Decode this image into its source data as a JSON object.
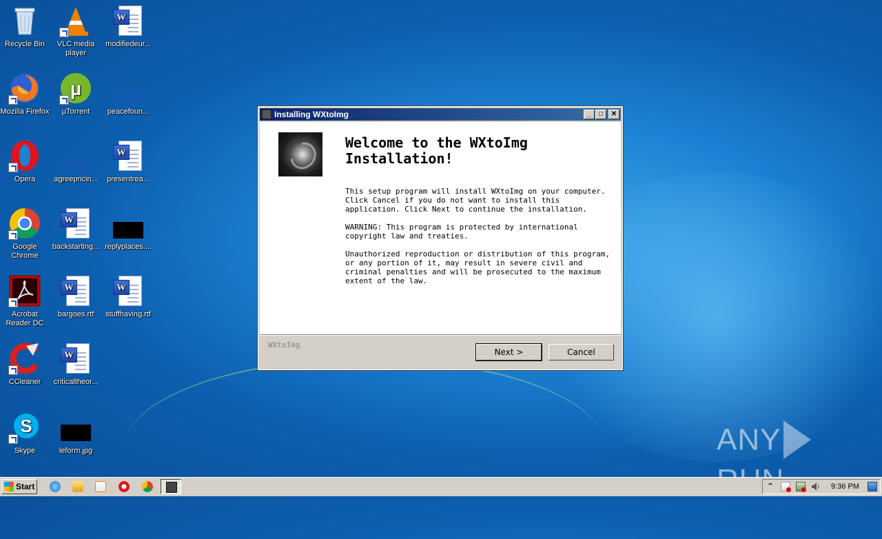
{
  "desktop": {
    "icons": [
      {
        "label": "Recycle Bin",
        "icon": "recycle-bin-icon"
      },
      {
        "label": "VLC media player",
        "icon": "vlc-icon"
      },
      {
        "label": "modifiedeur...",
        "icon": "word-document-icon"
      },
      {
        "label": "Mozilla Firefox",
        "icon": "firefox-icon"
      },
      {
        "label": "µTorrent",
        "icon": "utorrent-icon"
      },
      {
        "label": "peacefoun...",
        "icon": "file-icon"
      },
      {
        "label": "Opera",
        "icon": "opera-icon"
      },
      {
        "label": "agreepricin...",
        "icon": "file-icon"
      },
      {
        "label": "presentrea...",
        "icon": "word-document-icon"
      },
      {
        "label": "Google Chrome",
        "icon": "chrome-icon"
      },
      {
        "label": "backstarting...",
        "icon": "word-document-icon"
      },
      {
        "label": "replyplaces....",
        "icon": "black-thumbnail-icon"
      },
      {
        "label": "Acrobat Reader DC",
        "icon": "acrobat-icon"
      },
      {
        "label": "bargoes.rtf",
        "icon": "word-document-icon"
      },
      {
        "label": "stuffhaving.rtf",
        "icon": "word-document-icon"
      },
      {
        "label": "CCleaner",
        "icon": "ccleaner-icon"
      },
      {
        "label": "criticaltheor...",
        "icon": "word-document-icon"
      },
      {
        "label": "Skype",
        "icon": "skype-icon"
      },
      {
        "label": "leform.jpg",
        "icon": "black-thumbnail-icon"
      }
    ]
  },
  "dialog": {
    "title": "Installing WXtoImg",
    "heading": "Welcome to the WXtoImg Installation!",
    "paragraphs": [
      "This setup program will install WXtoImg on your computer. Click Cancel if you do not want to install this application. Click Next to continue the installation.",
      "WARNING: This program is protected by international copyright law and treaties.",
      "Unauthorized reproduction or distribution of this program, or any portion of it, may result in severe civil and criminal penalties and will be prosecuted to the maximum extent of the law."
    ],
    "brand": "WXtoImg",
    "next_label": "Next >",
    "cancel_label": "Cancel",
    "minimize_glyph": "_",
    "maximize_glyph": "□",
    "close_glyph": "✕"
  },
  "watermark": {
    "left": "ANY",
    "right": "RUN"
  },
  "taskbar": {
    "start_label": "Start",
    "clock": "9:36 PM",
    "tray_expand_glyph": "^"
  },
  "colors": {
    "titlebar_start": "#0a246a",
    "titlebar_end": "#3a6ea5",
    "desktop": "#1c82d4"
  }
}
